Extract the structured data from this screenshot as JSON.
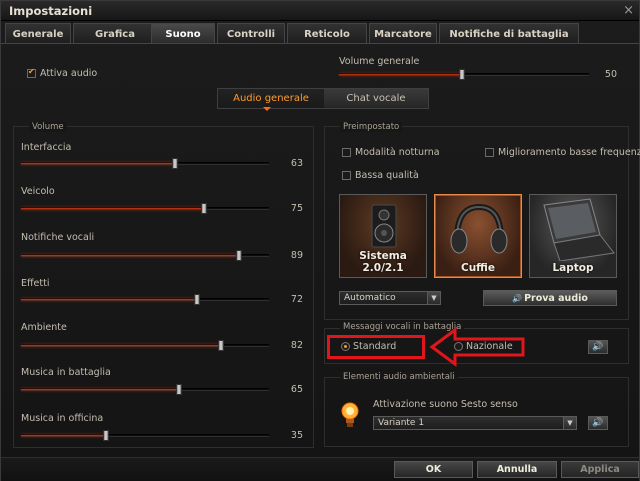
{
  "window": {
    "title": "Impostazioni",
    "close_symbol": "×"
  },
  "tabs": [
    {
      "label": "Generale"
    },
    {
      "label": "Grafica"
    },
    {
      "label": "Suono"
    },
    {
      "label": "Controlli"
    },
    {
      "label": "Reticolo"
    },
    {
      "label": "Marcatore"
    },
    {
      "label": "Notifiche di battaglia"
    }
  ],
  "audio": {
    "enable_label": "Attiva audio",
    "enabled": true,
    "master_label": "Volume generale",
    "master_value": "50"
  },
  "subtabs": [
    {
      "label": "Audio generale"
    },
    {
      "label": "Chat vocale"
    }
  ],
  "volume": {
    "title": "Volume",
    "sliders": [
      {
        "label": "Interfaccia",
        "value": "63"
      },
      {
        "label": "Veicolo",
        "value": "75"
      },
      {
        "label": "Notifiche vocali",
        "value": "89"
      },
      {
        "label": "Effetti",
        "value": "72"
      },
      {
        "label": "Ambiente",
        "value": "82"
      },
      {
        "label": "Musica in battaglia",
        "value": "65"
      },
      {
        "label": "Musica in officina",
        "value": "35"
      }
    ]
  },
  "preset": {
    "title": "Preimpostato",
    "night_mode": "Modalità notturna",
    "bass_boost": "Miglioramento basse frequenze",
    "low_quality": "Bassa qualità",
    "options": [
      {
        "label": "Sistema 2.0/2.1"
      },
      {
        "label": "Cuffie"
      },
      {
        "label": "Laptop"
      }
    ],
    "dropdown_value": "Automatico",
    "test_button": "Prova audio",
    "speaker_glyph": "🔊"
  },
  "voice_messages": {
    "title": "Messaggi vocali in battaglia",
    "standard": "Standard",
    "national": "Nazionale"
  },
  "ambient": {
    "title": "Elementi audio ambientali",
    "sixth_sense_label": "Attivazione suono Sesto senso",
    "variant_value": "Variante 1"
  },
  "footer": {
    "ok": "OK",
    "cancel": "Annulla",
    "apply": "Applica"
  },
  "colors": {
    "accent": "#ff9a2c",
    "highlight_red": "#e0161b",
    "slider_fill": "#b03012"
  }
}
